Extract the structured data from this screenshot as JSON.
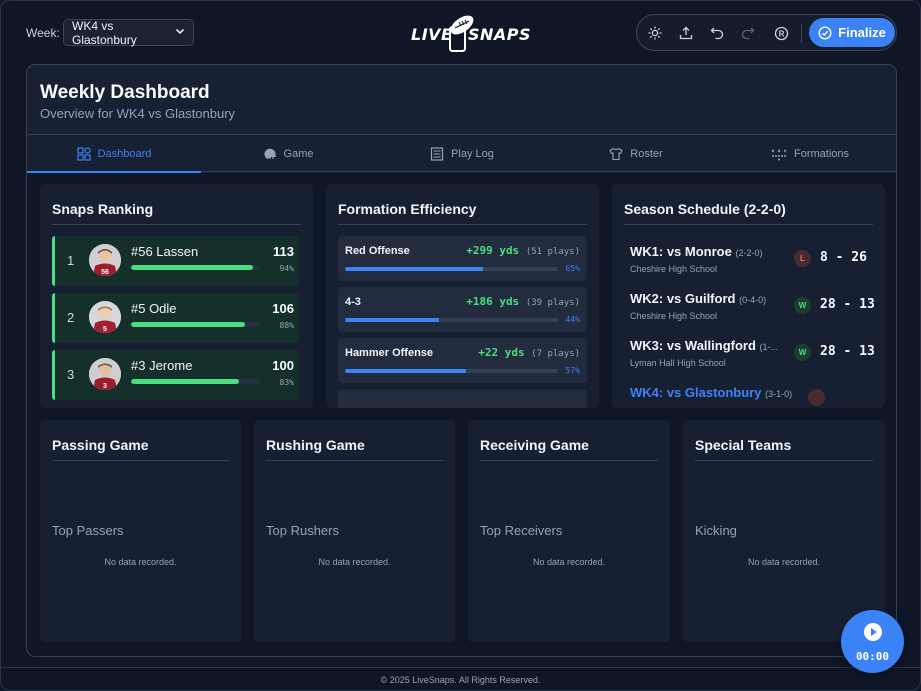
{
  "header": {
    "week_label": "Week:",
    "week_selected": "WK4 vs Glastonbury",
    "logo_left": "LIVE",
    "logo_right": "SNAPS",
    "finalize_label": "Finalize"
  },
  "dashboard": {
    "title": "Weekly Dashboard",
    "subtitle": "Overview for WK4 vs Glastonbury"
  },
  "tabs": [
    {
      "label": "Dashboard",
      "icon": "dashboard-icon",
      "active": true
    },
    {
      "label": "Game",
      "icon": "helmet-icon",
      "active": false
    },
    {
      "label": "Play Log",
      "icon": "list-icon",
      "active": false
    },
    {
      "label": "Roster",
      "icon": "jersey-icon",
      "active": false
    },
    {
      "label": "Formations",
      "icon": "formation-icon",
      "active": false
    }
  ],
  "snaps_ranking": {
    "title": "Snaps Ranking",
    "players": [
      {
        "rank": "1",
        "name": "#56 Lassen",
        "snaps": "113",
        "pct_label": "94%",
        "pct": 0.94,
        "jersey": "56"
      },
      {
        "rank": "2",
        "name": "#5 Odle",
        "snaps": "106",
        "pct_label": "88%",
        "pct": 0.88,
        "jersey": "5"
      },
      {
        "rank": "3",
        "name": "#3 Jerome",
        "snaps": "100",
        "pct_label": "83%",
        "pct": 0.83,
        "jersey": "3"
      }
    ]
  },
  "formation_efficiency": {
    "title": "Formation Efficiency",
    "formations": [
      {
        "name": "Red Offense",
        "yards": "+299 yds",
        "plays": "(51 plays)",
        "pct_label": "65%",
        "pct": 0.65
      },
      {
        "name": "4-3",
        "yards": "+186 yds",
        "plays": "(39 plays)",
        "pct_label": "44%",
        "pct": 0.44
      },
      {
        "name": "Hammer Offense",
        "yards": "+22 yds",
        "plays": "(7 plays)",
        "pct_label": "57%",
        "pct": 0.57
      }
    ]
  },
  "schedule": {
    "title": "Season Schedule (2-2-0)",
    "games": [
      {
        "title": "WK1: vs Monroe",
        "record": "(2-2-0)",
        "school": "Cheshire High School",
        "result": "L",
        "score": "8 - 26"
      },
      {
        "title": "WK2: vs Guilford",
        "record": "(0-4-0)",
        "school": "Cheshire High School",
        "result": "W",
        "score": "28 - 13"
      },
      {
        "title": "WK3: vs Wallingford",
        "record": "(1-...",
        "school": "Lyman Hall High School",
        "result": "W",
        "score": "28 - 13"
      },
      {
        "title": "WK4: vs Glastonbury",
        "record": "(3-1-0)",
        "school": "",
        "result": "",
        "score": ""
      }
    ]
  },
  "stat_cards": [
    {
      "title": "Passing Game",
      "subtitle": "Top Passers",
      "empty": "No data recorded."
    },
    {
      "title": "Rushing Game",
      "subtitle": "Top Rushers",
      "empty": "No data recorded."
    },
    {
      "title": "Receiving Game",
      "subtitle": "Top Receivers",
      "empty": "No data recorded."
    },
    {
      "title": "Special Teams",
      "subtitle": "Kicking",
      "empty": "No data recorded."
    }
  ],
  "timer": {
    "value": "00:00"
  },
  "footer": {
    "text": "© 2025 LiveSnaps. All Rights Reserved."
  },
  "colors": {
    "accent": "#3b82f6",
    "positive": "#4ade80",
    "negative": "#f87171",
    "background": "#0f1626"
  }
}
